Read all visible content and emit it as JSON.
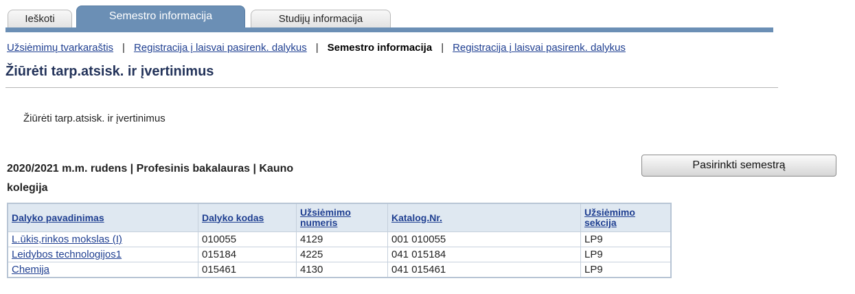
{
  "tabs": [
    {
      "label": "Ieškoti"
    },
    {
      "label": "Semestro informacija"
    },
    {
      "label": "Studijų informacija"
    }
  ],
  "sublinks": [
    {
      "label": "Užsiėmimų tvarkaraštis"
    },
    {
      "label": "Registracija į laisvai pasirenk. dalykus"
    },
    {
      "label": "Semestro informacija"
    },
    {
      "label": "Registracija į laisvai pasirenk. dalykus"
    }
  ],
  "separator": "|",
  "page_title": "Žiūrėti tarp.atsisk. ir įvertinimus",
  "instruction": "Žiūrėti tarp.atsisk. ir įvertinimus",
  "term_line1": "2020/2021 m.m. rudens | Profesinis bakalauras | Kauno",
  "term_line2": "kolegija",
  "change_term_button": "Pasirinkti semestrą",
  "table": {
    "headers": [
      {
        "line1": "Dalyko pavadinimas",
        "line2": ""
      },
      {
        "line1": "Dalyko kodas",
        "line2": ""
      },
      {
        "line1": "Užsiėmimo",
        "line2": "numeris"
      },
      {
        "line1": "Katalog.Nr.",
        "line2": ""
      },
      {
        "line1": "Užsiėmimo",
        "line2": "sekcija"
      }
    ],
    "rows": [
      {
        "name": "L.ūkis,rinkos mokslas (I)",
        "code": "010055",
        "number": "4129",
        "catalog": "001 010055",
        "section": "LP9"
      },
      {
        "name": "Leidybos technologijos1",
        "code": "015184",
        "number": "4225",
        "catalog": "041 015184",
        "section": "LP9"
      },
      {
        "name": "Chemija",
        "code": "015461",
        "number": "4130",
        "catalog": "041 015461",
        "section": "LP9"
      }
    ]
  }
}
